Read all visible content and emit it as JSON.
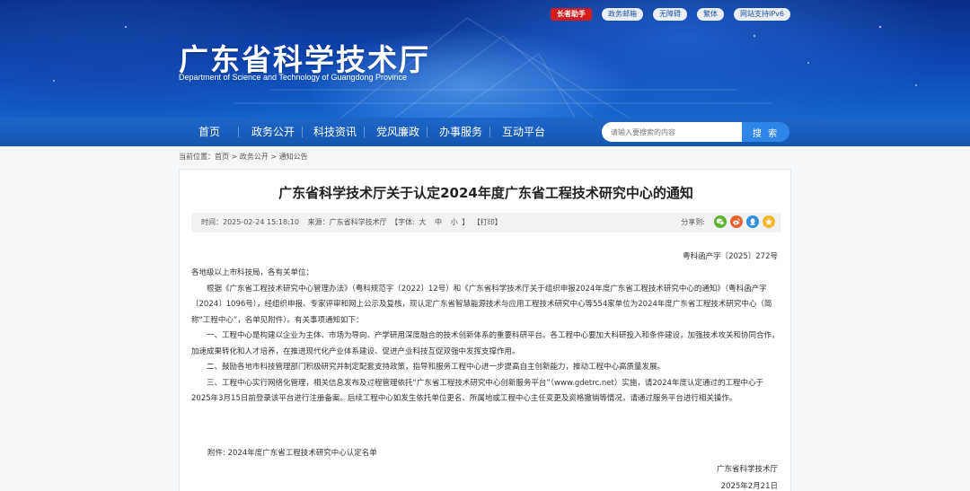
{
  "top_links": [
    "长者助手",
    "政务邮箱",
    "无障碍",
    "繁体",
    "网站支持IPv6"
  ],
  "site": {
    "title": "广东省科学技术厅",
    "subtitle": "Department of Science and Technology of Guangdong Province"
  },
  "nav": [
    "首页",
    "政务公开",
    "科技资讯",
    "党风廉政",
    "办事服务",
    "互动平台"
  ],
  "search": {
    "placeholder": "请输入要搜索的内容",
    "button": "搜 索"
  },
  "breadcrumb": {
    "prefix": "当前位置：",
    "items": [
      "首页",
      "政务公开",
      "通知公告"
    ],
    "separator": " > "
  },
  "article": {
    "title": "广东省科学技术厅关于认定2024年度广东省工程技术研究中心的通知",
    "meta": {
      "time": "时间：2025-02-24 15:18:10",
      "source": "来源：广东省科学技术厅",
      "font_label": "【字体:",
      "font_big": "大",
      "font_mid": "中",
      "font_small": "小",
      "font_end": "】",
      "print": "【打印】"
    },
    "share_label": "分享到:",
    "doc_no": "粤科函产字〔2025〕272号",
    "paragraphs": [
      "各地级以上市科技局，各有关单位：",
      "根据《广东省工程技术研究中心管理办法》（粤科规范字〔2022〕12号）和《广东省科学技术厅关于组织申报2024年度广东省工程技术研究中心的通知》（粤科函产字〔2024〕1096号），经组织申报、专家评审和网上公示及复核，现认定广东省智慧能源技术与应用工程技术研究中心等554家单位为2024年度广东省工程技术研究中心（简称“工程中心”，名单见附件）。有关事项通知如下：",
      "一、工程中心是构建以企业为主体、市场为导向、产学研用深度融合的技术创新体系的重要科研平台。各工程中心要加大科研投入和条件建设，加强技术攻关和协同合作，加速成果转化和人才培养，在推进现代化产业体系建设、促进产业科技互促双强中发挥支撑作用。",
      "二、鼓励各地市科技管理部门积极研究并制定配套支持政策，指导和服务工程中心进一步提高自主创新能力，推动工程中心高质量发展。",
      "三、工程中心实行网络化管理，相关信息发布及过程管理依托“广东省工程技术研究中心创新服务平台”（www.gdetrc.net）实施，请2024年度认定通过的工程中心于2025年3月15日前登录该平台进行注册备案。后续工程中心如发生依托单位更名、所属地或工程中心主任变更及资格撤销等情况，请通过服务平台进行相关操作。"
    ],
    "attachment": "附件: 2024年度广东省工程技术研究中心认定名单",
    "signature": "广东省科学技术厅",
    "date": "2025年2月21日"
  },
  "colors": {
    "banner_dark": "#0a2f86",
    "nav_blue": "#1556b3",
    "search_button": "#2f86e8",
    "badge_red": "#d31d1d",
    "share_wechat": "#5cb531",
    "share_weibo": "#e8632e",
    "share_qq": "#2f8fe0",
    "share_qzone": "#f3b72b"
  }
}
